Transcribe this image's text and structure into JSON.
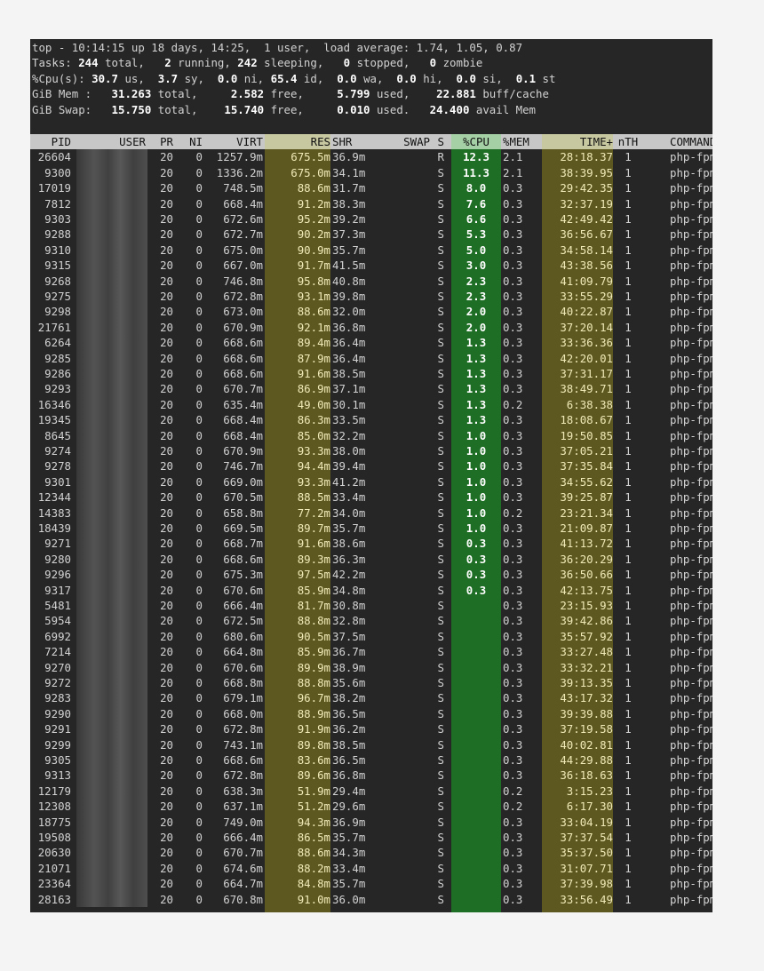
{
  "summary": {
    "line1": {
      "prefix": "top - ",
      "time": "10:14:15",
      "up": " up 18 days, 14:25,  ",
      "users": "1 user,  ",
      "load": "load average: 1.74, 1.05, 0.87"
    },
    "tasks": {
      "label": "Tasks: ",
      "total": "244",
      "total_l": " total,   ",
      "running": "2",
      "running_l": " running, ",
      "sleeping": "242",
      "sleeping_l": " sleeping,   ",
      "stopped": "0",
      "stopped_l": " stopped,   ",
      "zombie": "0",
      "zombie_l": " zombie"
    },
    "cpu": {
      "label": "%Cpu(s): ",
      "us": "30.7",
      "us_l": " us,  ",
      "sy": "3.7",
      "sy_l": " sy,  ",
      "ni": "0.0",
      "ni_l": " ni, ",
      "id": "65.4",
      "id_l": " id,  ",
      "wa": "0.0",
      "wa_l": " wa,  ",
      "hi": "0.0",
      "hi_l": " hi,  ",
      "si": "0.0",
      "si_l": " si,  ",
      "st": "0.1",
      "st_l": " st"
    },
    "mem": {
      "label": "GiB Mem :   ",
      "total": "31.263",
      "total_l": " total,     ",
      "free": "2.582",
      "free_l": " free,     ",
      "used": "5.799",
      "used_l": " used,    ",
      "buff": "22.881",
      "buff_l": " buff/cache"
    },
    "swap": {
      "label": "GiB Swap:   ",
      "total": "15.750",
      "total_l": " total,    ",
      "free": "15.740",
      "free_l": " free,     ",
      "used": "0.010",
      "used_l": " used.   ",
      "avail": "24.400",
      "avail_l": " avail Mem"
    }
  },
  "columns": [
    "PID",
    "USER",
    "PR",
    "NI",
    "VIRT",
    "RES",
    "SHR",
    "SWAP",
    "S",
    "%CPU",
    "%MEM",
    "TIME+",
    "nTH",
    "COMMAND"
  ],
  "processes": [
    [
      "26604",
      "",
      "20",
      "0",
      "1257.9m",
      "675.5m",
      "36.9m",
      "",
      "R",
      "12.3",
      "2.1",
      "28:18.37",
      "1",
      "php-fpm"
    ],
    [
      "9300",
      "",
      "20",
      "0",
      "1336.2m",
      "675.0m",
      "34.1m",
      "",
      "S",
      "11.3",
      "2.1",
      "38:39.95",
      "1",
      "php-fpm"
    ],
    [
      "17019",
      "",
      "20",
      "0",
      "748.5m",
      "88.6m",
      "31.7m",
      "",
      "S",
      "8.0",
      "0.3",
      "29:42.35",
      "1",
      "php-fpm"
    ],
    [
      "7812",
      "",
      "20",
      "0",
      "668.4m",
      "91.2m",
      "38.3m",
      "",
      "S",
      "7.6",
      "0.3",
      "32:37.19",
      "1",
      "php-fpm"
    ],
    [
      "9303",
      "",
      "20",
      "0",
      "672.6m",
      "95.2m",
      "39.2m",
      "",
      "S",
      "6.6",
      "0.3",
      "42:49.42",
      "1",
      "php-fpm"
    ],
    [
      "9288",
      "",
      "20",
      "0",
      "672.7m",
      "90.2m",
      "37.3m",
      "",
      "S",
      "5.3",
      "0.3",
      "36:56.67",
      "1",
      "php-fpm"
    ],
    [
      "9310",
      "",
      "20",
      "0",
      "675.0m",
      "90.9m",
      "35.7m",
      "",
      "S",
      "5.0",
      "0.3",
      "34:58.14",
      "1",
      "php-fpm"
    ],
    [
      "9315",
      "",
      "20",
      "0",
      "667.0m",
      "91.7m",
      "41.5m",
      "",
      "S",
      "3.0",
      "0.3",
      "43:38.56",
      "1",
      "php-fpm"
    ],
    [
      "9268",
      "",
      "20",
      "0",
      "746.8m",
      "95.8m",
      "40.8m",
      "",
      "S",
      "2.3",
      "0.3",
      "41:09.79",
      "1",
      "php-fpm"
    ],
    [
      "9275",
      "",
      "20",
      "0",
      "672.8m",
      "93.1m",
      "39.8m",
      "",
      "S",
      "2.3",
      "0.3",
      "33:55.29",
      "1",
      "php-fpm"
    ],
    [
      "9298",
      "",
      "20",
      "0",
      "673.0m",
      "88.6m",
      "32.0m",
      "",
      "S",
      "2.0",
      "0.3",
      "40:22.87",
      "1",
      "php-fpm"
    ],
    [
      "21761",
      "",
      "20",
      "0",
      "670.9m",
      "92.1m",
      "36.8m",
      "",
      "S",
      "2.0",
      "0.3",
      "37:20.14",
      "1",
      "php-fpm"
    ],
    [
      "6264",
      "",
      "20",
      "0",
      "668.6m",
      "89.4m",
      "36.4m",
      "",
      "S",
      "1.3",
      "0.3",
      "33:36.36",
      "1",
      "php-fpm"
    ],
    [
      "9285",
      "",
      "20",
      "0",
      "668.6m",
      "87.9m",
      "36.4m",
      "",
      "S",
      "1.3",
      "0.3",
      "42:20.01",
      "1",
      "php-fpm"
    ],
    [
      "9286",
      "",
      "20",
      "0",
      "668.6m",
      "91.6m",
      "38.5m",
      "",
      "S",
      "1.3",
      "0.3",
      "37:31.17",
      "1",
      "php-fpm"
    ],
    [
      "9293",
      "",
      "20",
      "0",
      "670.7m",
      "86.9m",
      "37.1m",
      "",
      "S",
      "1.3",
      "0.3",
      "38:49.71",
      "1",
      "php-fpm"
    ],
    [
      "16346",
      "",
      "20",
      "0",
      "635.4m",
      "49.0m",
      "30.1m",
      "",
      "S",
      "1.3",
      "0.2",
      "6:38.38",
      "1",
      "php-fpm"
    ],
    [
      "19345",
      "",
      "20",
      "0",
      "668.4m",
      "86.3m",
      "33.5m",
      "",
      "S",
      "1.3",
      "0.3",
      "18:08.67",
      "1",
      "php-fpm"
    ],
    [
      "8645",
      "",
      "20",
      "0",
      "668.4m",
      "85.0m",
      "32.2m",
      "",
      "S",
      "1.0",
      "0.3",
      "19:50.85",
      "1",
      "php-fpm"
    ],
    [
      "9274",
      "",
      "20",
      "0",
      "670.9m",
      "93.3m",
      "38.0m",
      "",
      "S",
      "1.0",
      "0.3",
      "37:05.21",
      "1",
      "php-fpm"
    ],
    [
      "9278",
      "",
      "20",
      "0",
      "746.7m",
      "94.4m",
      "39.4m",
      "",
      "S",
      "1.0",
      "0.3",
      "37:35.84",
      "1",
      "php-fpm"
    ],
    [
      "9301",
      "",
      "20",
      "0",
      "669.0m",
      "93.3m",
      "41.2m",
      "",
      "S",
      "1.0",
      "0.3",
      "34:55.62",
      "1",
      "php-fpm"
    ],
    [
      "12344",
      "",
      "20",
      "0",
      "670.5m",
      "88.5m",
      "33.4m",
      "",
      "S",
      "1.0",
      "0.3",
      "39:25.87",
      "1",
      "php-fpm"
    ],
    [
      "14383",
      "",
      "20",
      "0",
      "658.8m",
      "77.2m",
      "34.0m",
      "",
      "S",
      "1.0",
      "0.2",
      "23:21.34",
      "1",
      "php-fpm"
    ],
    [
      "18439",
      "",
      "20",
      "0",
      "669.5m",
      "89.7m",
      "35.7m",
      "",
      "S",
      "1.0",
      "0.3",
      "21:09.87",
      "1",
      "php-fpm"
    ],
    [
      "9271",
      "",
      "20",
      "0",
      "668.7m",
      "91.6m",
      "38.6m",
      "",
      "S",
      "0.3",
      "0.3",
      "41:13.72",
      "1",
      "php-fpm"
    ],
    [
      "9280",
      "",
      "20",
      "0",
      "668.6m",
      "89.3m",
      "36.3m",
      "",
      "S",
      "0.3",
      "0.3",
      "36:20.29",
      "1",
      "php-fpm"
    ],
    [
      "9296",
      "",
      "20",
      "0",
      "675.3m",
      "97.5m",
      "42.2m",
      "",
      "S",
      "0.3",
      "0.3",
      "36:50.66",
      "1",
      "php-fpm"
    ],
    [
      "9317",
      "",
      "20",
      "0",
      "670.6m",
      "85.9m",
      "34.8m",
      "",
      "S",
      "0.3",
      "0.3",
      "42:13.75",
      "1",
      "php-fpm"
    ],
    [
      "5481",
      "",
      "20",
      "0",
      "666.4m",
      "81.7m",
      "30.8m",
      "",
      "S",
      "",
      "0.3",
      "23:15.93",
      "1",
      "php-fpm"
    ],
    [
      "5954",
      "",
      "20",
      "0",
      "672.5m",
      "88.8m",
      "32.8m",
      "",
      "S",
      "",
      "0.3",
      "39:42.86",
      "1",
      "php-fpm"
    ],
    [
      "6992",
      "",
      "20",
      "0",
      "680.6m",
      "90.5m",
      "37.5m",
      "",
      "S",
      "",
      "0.3",
      "35:57.92",
      "1",
      "php-fpm"
    ],
    [
      "7214",
      "",
      "20",
      "0",
      "664.8m",
      "85.9m",
      "36.7m",
      "",
      "S",
      "",
      "0.3",
      "33:27.48",
      "1",
      "php-fpm"
    ],
    [
      "9270",
      "",
      "20",
      "0",
      "670.6m",
      "89.9m",
      "38.9m",
      "",
      "S",
      "",
      "0.3",
      "33:32.21",
      "1",
      "php-fpm"
    ],
    [
      "9272",
      "",
      "20",
      "0",
      "668.8m",
      "88.8m",
      "35.6m",
      "",
      "S",
      "",
      "0.3",
      "39:13.35",
      "1",
      "php-fpm"
    ],
    [
      "9283",
      "",
      "20",
      "0",
      "679.1m",
      "96.7m",
      "38.2m",
      "",
      "S",
      "",
      "0.3",
      "43:17.32",
      "1",
      "php-fpm"
    ],
    [
      "9290",
      "",
      "20",
      "0",
      "668.0m",
      "88.9m",
      "36.5m",
      "",
      "S",
      "",
      "0.3",
      "39:39.88",
      "1",
      "php-fpm"
    ],
    [
      "9291",
      "",
      "20",
      "0",
      "672.8m",
      "91.9m",
      "36.2m",
      "",
      "S",
      "",
      "0.3",
      "37:19.58",
      "1",
      "php-fpm"
    ],
    [
      "9299",
      "",
      "20",
      "0",
      "743.1m",
      "89.8m",
      "38.5m",
      "",
      "S",
      "",
      "0.3",
      "40:02.81",
      "1",
      "php-fpm"
    ],
    [
      "9305",
      "",
      "20",
      "0",
      "668.6m",
      "83.6m",
      "36.5m",
      "",
      "S",
      "",
      "0.3",
      "44:29.88",
      "1",
      "php-fpm"
    ],
    [
      "9313",
      "",
      "20",
      "0",
      "672.8m",
      "89.6m",
      "36.8m",
      "",
      "S",
      "",
      "0.3",
      "36:18.63",
      "1",
      "php-fpm"
    ],
    [
      "12179",
      "",
      "20",
      "0",
      "638.3m",
      "51.9m",
      "29.4m",
      "",
      "S",
      "",
      "0.2",
      "3:15.23",
      "1",
      "php-fpm"
    ],
    [
      "12308",
      "",
      "20",
      "0",
      "637.1m",
      "51.2m",
      "29.6m",
      "",
      "S",
      "",
      "0.2",
      "6:17.30",
      "1",
      "php-fpm"
    ],
    [
      "18775",
      "",
      "20",
      "0",
      "749.0m",
      "94.3m",
      "36.9m",
      "",
      "S",
      "",
      "0.3",
      "33:04.19",
      "1",
      "php-fpm"
    ],
    [
      "19508",
      "",
      "20",
      "0",
      "666.4m",
      "86.5m",
      "35.7m",
      "",
      "S",
      "",
      "0.3",
      "37:37.54",
      "1",
      "php-fpm"
    ],
    [
      "20630",
      "",
      "20",
      "0",
      "670.7m",
      "88.6m",
      "34.3m",
      "",
      "S",
      "",
      "0.3",
      "35:37.50",
      "1",
      "php-fpm"
    ],
    [
      "21071",
      "",
      "20",
      "0",
      "674.6m",
      "88.2m",
      "33.4m",
      "",
      "S",
      "",
      "0.3",
      "31:07.71",
      "1",
      "php-fpm"
    ],
    [
      "23364",
      "",
      "20",
      "0",
      "664.7m",
      "84.8m",
      "35.7m",
      "",
      "S",
      "",
      "0.3",
      "37:39.98",
      "1",
      "php-fpm"
    ],
    [
      "28163",
      "",
      "20",
      "0",
      "670.8m",
      "91.0m",
      "36.0m",
      "",
      "S",
      "",
      "0.3",
      "33:56.49",
      "1",
      "php-fpm"
    ]
  ]
}
